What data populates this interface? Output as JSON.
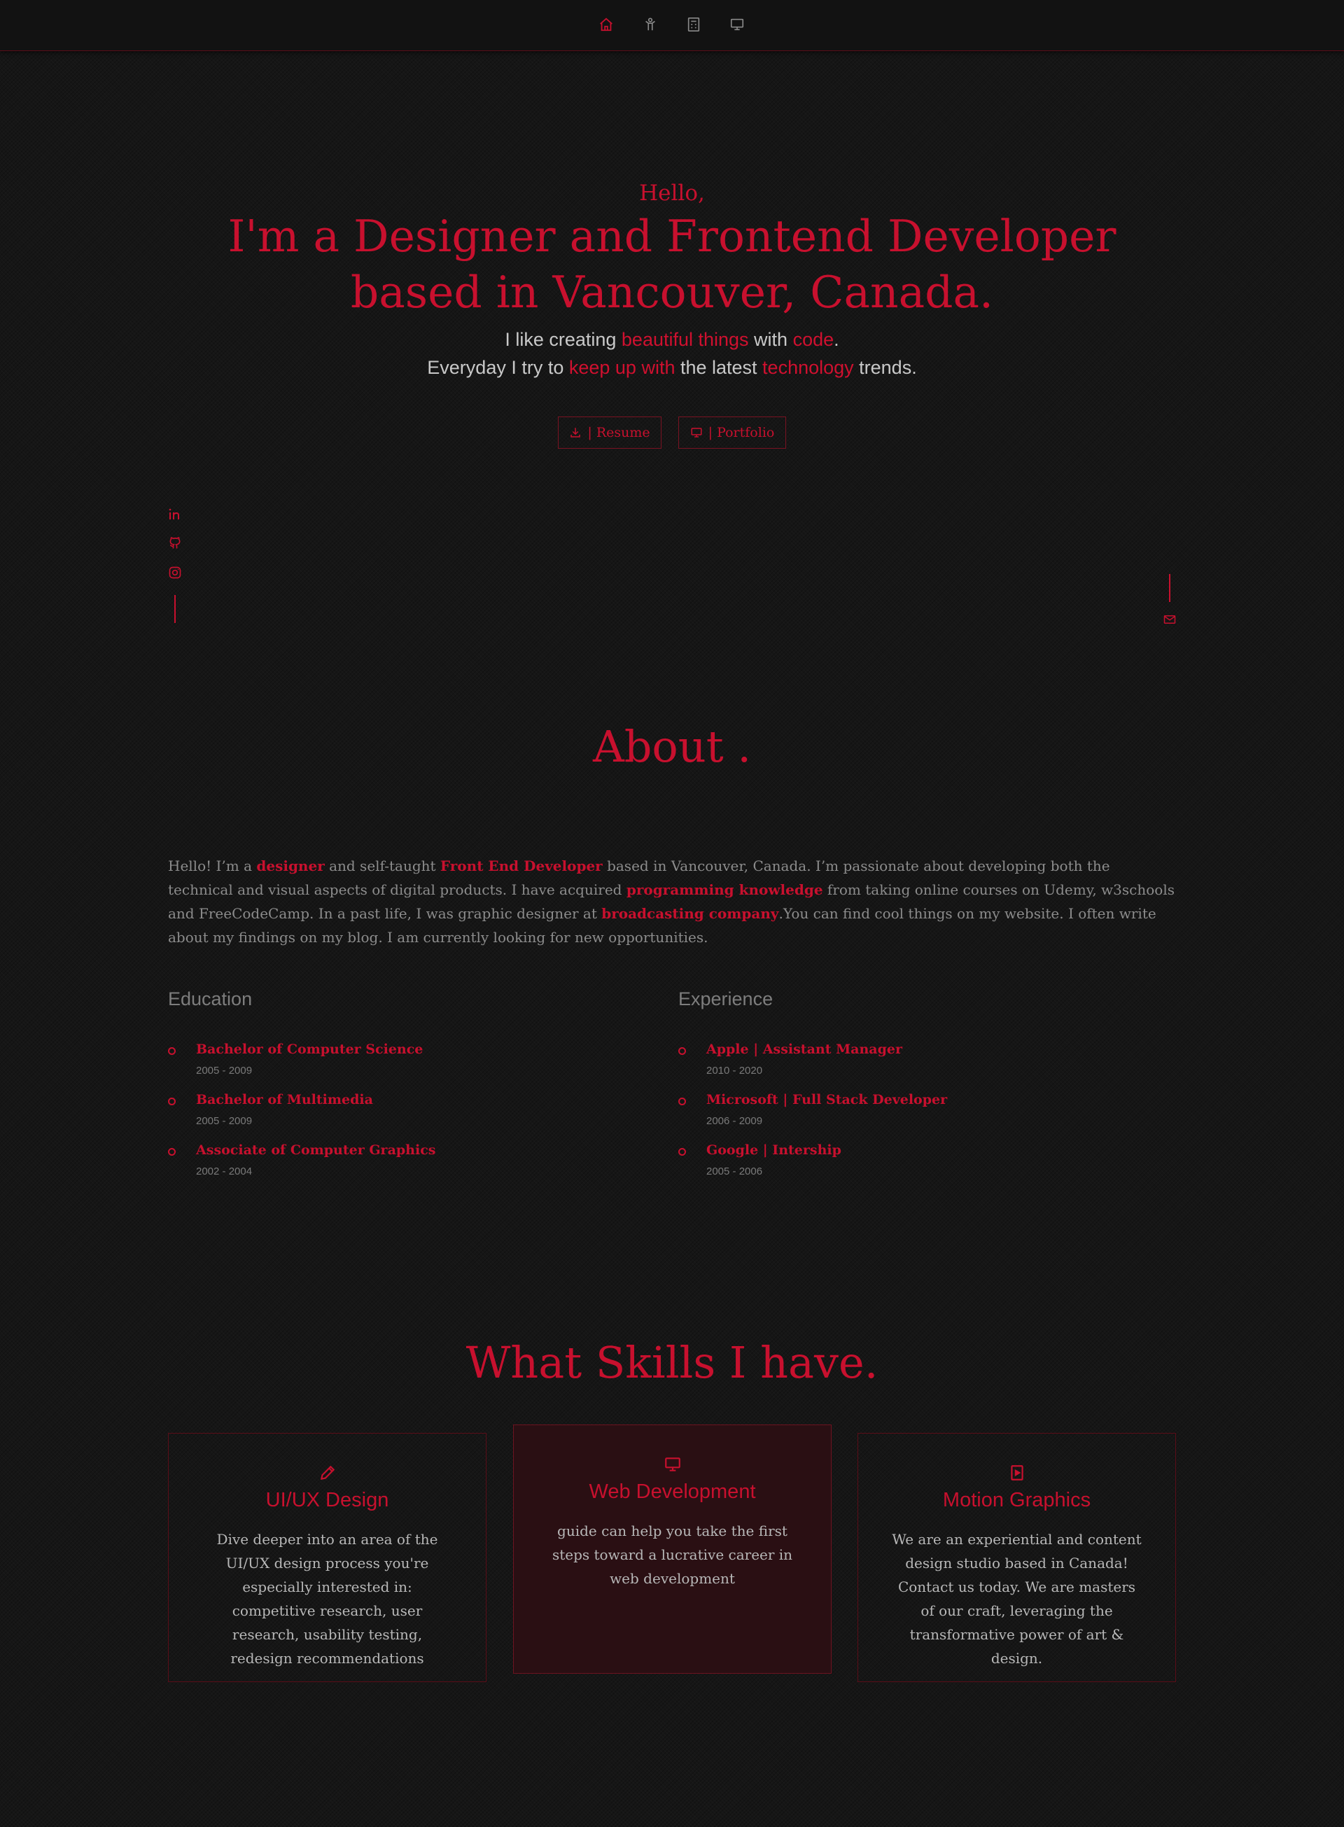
{
  "colors": {
    "accent": "#c8102e",
    "background": "#161616"
  },
  "nav": {
    "items": [
      {
        "icon": "home-icon"
      },
      {
        "icon": "person-icon"
      },
      {
        "icon": "calculator-icon"
      },
      {
        "icon": "monitor-icon"
      }
    ]
  },
  "hero": {
    "greeting": "Hello,",
    "title_line1": "I'm a Designer and Frontend Developer",
    "title_line2": "based in Vancouver, Canada.",
    "line1": {
      "a": "I like creating ",
      "b": "beautiful things",
      "c": " with ",
      "d": "code",
      "e": "."
    },
    "line2": {
      "a": "Everyday I try to ",
      "b": "keep up with",
      "c": " the latest ",
      "d": "technology",
      "e": " trends."
    },
    "resume_label": "| Resume",
    "portfolio_label": "| Portfolio"
  },
  "social": {
    "icons": [
      "linkedin-icon",
      "github-icon",
      "instagram-icon"
    ],
    "email_icon": "mail-icon"
  },
  "about": {
    "title": "About .",
    "p": {
      "t1": "Hello! I’m a ",
      "h1": "designer",
      "t2": " and self-taught ",
      "h2": "Front End Developer",
      "t3": " based in Vancouver, Canada. I’m passionate about developing both the technical and visual aspects of digital products. I have acquired ",
      "h3": "programming knowledge",
      "t4": " from taking online courses on Udemy, w3schools and FreeCodeCamp. In a past life, I was graphic designer at ",
      "h4": "broadcasting company",
      "t5": ".You can find cool things on my website. I often write about my findings on my blog. I am currently looking for new opportunities."
    },
    "education": {
      "heading": "Education",
      "items": [
        {
          "title": "Bachelor of Computer Science",
          "date": "2005 - 2009"
        },
        {
          "title": "Bachelor of Multimedia",
          "date": "2005 - 2009"
        },
        {
          "title": "Associate of Computer Graphics",
          "date": "2002 - 2004"
        }
      ]
    },
    "experience": {
      "heading": "Experience",
      "items": [
        {
          "title": "Apple | Assistant Manager",
          "date": "2010 - 2020"
        },
        {
          "title": "Microsoft | Full Stack Developer",
          "date": "2006 - 2009"
        },
        {
          "title": "Google | Intership",
          "date": "2005 - 2006"
        }
      ]
    }
  },
  "skills": {
    "title": "What Skills I have.",
    "cards": [
      {
        "icon": "pencil-icon",
        "title": "UI/UX Design",
        "text": "Dive deeper into an area of the UI/UX design process you're especially interested in: competitive research, user research, usability testing, redesign recommendations"
      },
      {
        "icon": "monitor-icon",
        "title": "Web Development",
        "text": "guide can help you take the first steps toward a lucrative career in web development"
      },
      {
        "icon": "play-file-icon",
        "title": "Motion Graphics",
        "text": "We are an experiential and content design studio based in Canada! Contact us today. We are masters of our craft, leveraging the transformative power of art & design."
      }
    ]
  }
}
